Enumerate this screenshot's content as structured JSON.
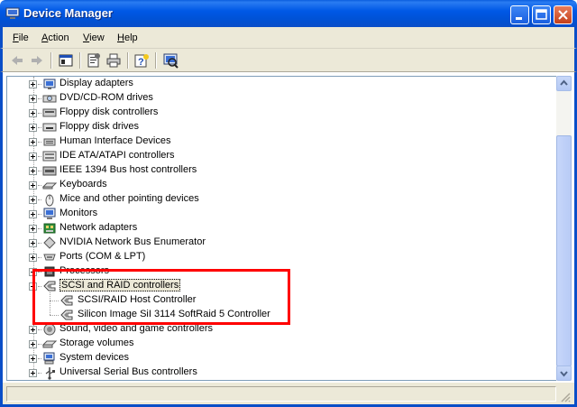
{
  "window": {
    "title": "Device Manager"
  },
  "menu": [
    {
      "key": "F",
      "rest": "ile"
    },
    {
      "key": "A",
      "rest": "ction"
    },
    {
      "key": "V",
      "rest": "iew"
    },
    {
      "key": "H",
      "rest": "elp"
    }
  ],
  "toolbar": {
    "buttons": [
      "back-icon",
      "forward-icon",
      "show-hide-console-tree-icon",
      "properties-icon",
      "print-icon",
      "help-icon",
      "scan-hardware-icon"
    ]
  },
  "tree": {
    "items": [
      {
        "label": "Display adapters",
        "icon": "display-adapter-icon"
      },
      {
        "label": "DVD/CD-ROM drives",
        "icon": "cd-drive-icon"
      },
      {
        "label": "Floppy disk controllers",
        "icon": "floppy-controller-icon"
      },
      {
        "label": "Floppy disk drives",
        "icon": "floppy-drive-icon"
      },
      {
        "label": "Human Interface Devices",
        "icon": "hid-icon"
      },
      {
        "label": "IDE ATA/ATAPI controllers",
        "icon": "ide-controller-icon"
      },
      {
        "label": "IEEE 1394 Bus host controllers",
        "icon": "ieee1394-icon"
      },
      {
        "label": "Keyboards",
        "icon": "keyboard-icon"
      },
      {
        "label": "Mice and other pointing devices",
        "icon": "mouse-icon"
      },
      {
        "label": "Monitors",
        "icon": "monitor-icon"
      },
      {
        "label": "Network adapters",
        "icon": "network-adapter-icon"
      },
      {
        "label": "NVIDIA Network Bus Enumerator",
        "icon": "bus-enumerator-icon"
      },
      {
        "label": "Ports (COM & LPT)",
        "icon": "port-icon"
      },
      {
        "label": "Processors",
        "icon": "processor-icon"
      },
      {
        "label": "SCSI and RAID controllers",
        "icon": "scsi-icon",
        "expanded": true,
        "selected": true
      },
      {
        "label": "SCSI/RAID Host Controller",
        "icon": "scsi-icon",
        "child": true
      },
      {
        "label": "Silicon Image SiI 3114 SoftRaid 5 Controller",
        "icon": "scsi-icon",
        "child": true
      },
      {
        "label": "Sound, video and game controllers",
        "icon": "sound-icon"
      },
      {
        "label": "Storage volumes",
        "icon": "storage-volume-icon"
      },
      {
        "label": "System devices",
        "icon": "system-device-icon"
      },
      {
        "label": "Universal Serial Bus controllers",
        "icon": "usb-icon"
      }
    ]
  },
  "status": {
    "text": ""
  },
  "colors": {
    "title_bar": "#0058e6",
    "highlight_box": "#ff0000",
    "chrome": "#ece9d8"
  }
}
